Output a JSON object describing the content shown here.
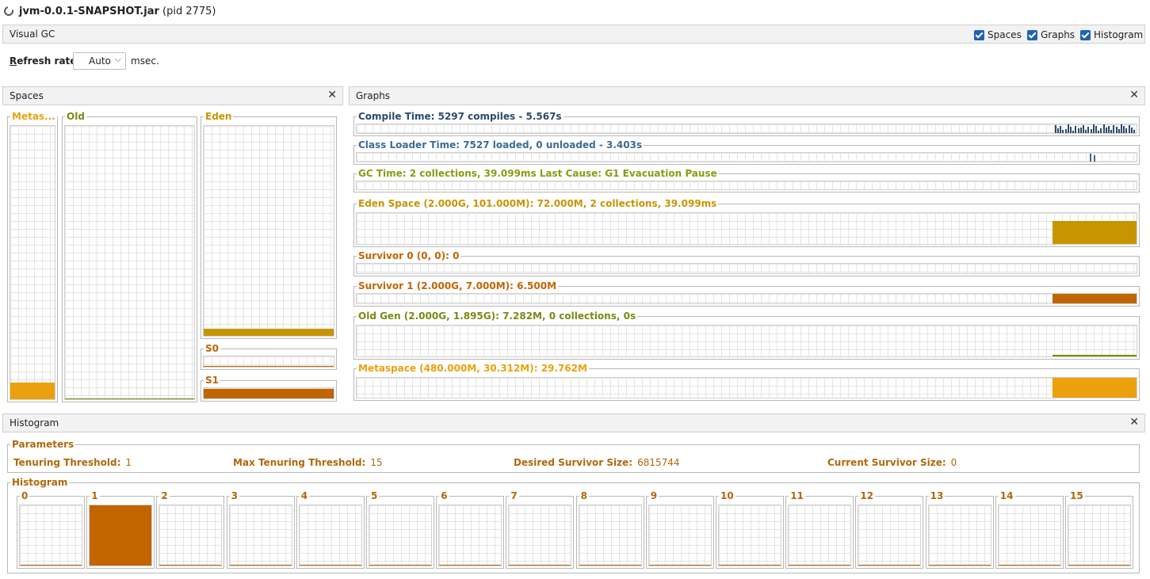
{
  "window": {
    "title_bold": "jvm-0.0.1-SNAPSHOT.jar",
    "title_rest": " (pid 2775)"
  },
  "visualgc": {
    "title": "Visual GC",
    "checkboxes": {
      "spaces": "Spaces",
      "graphs": "Graphs",
      "histogram": "Histogram"
    }
  },
  "refresh": {
    "label_underlined": "R",
    "label_rest": "efresh rate:",
    "value": "Auto",
    "unit": "msec."
  },
  "spaces": {
    "title": "Spaces",
    "metaspace": {
      "label": "Metas...",
      "fill": 0.06
    },
    "old": {
      "label": "Old",
      "fill": 0.004
    },
    "eden": {
      "label": "Eden",
      "fill": 0.035
    },
    "s0": {
      "label": "S0",
      "fill": 0.0
    },
    "s1": {
      "label": "S1",
      "fill": 0.93
    }
  },
  "graphs": {
    "title": "Graphs",
    "compile": "Compile Time: 5297 compiles - 5.567s",
    "classloader": "Class Loader Time: 7527 loaded, 0 unloaded - 3.403s",
    "gc": "GC Time: 2 collections, 39.099ms Last Cause: G1 Evacuation Pause",
    "eden": "Eden Space (2.000G, 101.000M): 72.000M, 2 collections, 39.099ms",
    "survivor0": "Survivor 0 (0, 0): 0",
    "survivor1": "Survivor 1 (2.000G, 7.000M): 6.500M",
    "oldgen": "Old Gen (2.000G, 1.895G): 7.282M, 0 collections, 0s",
    "metaspace": "Metaspace (480.000M, 30.312M): 29.762M"
  },
  "histogram": {
    "title": "Histogram",
    "parameters_title": "Parameters",
    "params": {
      "tenuring_label": "Tenuring Threshold:",
      "tenuring_value": "1",
      "max_tenuring_label": "Max Tenuring Threshold:",
      "max_tenuring_value": "15",
      "desired_label": "Desired Survivor Size:",
      "desired_value": "6815744",
      "current_label": "Current Survivor Size:",
      "current_value": "0"
    },
    "histogram_title": "Histogram",
    "bins": [
      "0",
      "1",
      "2",
      "3",
      "4",
      "5",
      "6",
      "7",
      "8",
      "9",
      "10",
      "11",
      "12",
      "13",
      "14",
      "15"
    ],
    "bin_fill": [
      0,
      1,
      0,
      0,
      0,
      0,
      0,
      0,
      0,
      0,
      0,
      0,
      0,
      0,
      0,
      0
    ]
  },
  "colors": {
    "metaspace": "#eba10e",
    "eden": "#c89400",
    "survivor": "#c26400",
    "old": "#7a8a12",
    "compile": "#2b4a6a",
    "classloader": "#3a6b95",
    "gc": "#8a9b10",
    "label_orange": "#b0680a"
  }
}
